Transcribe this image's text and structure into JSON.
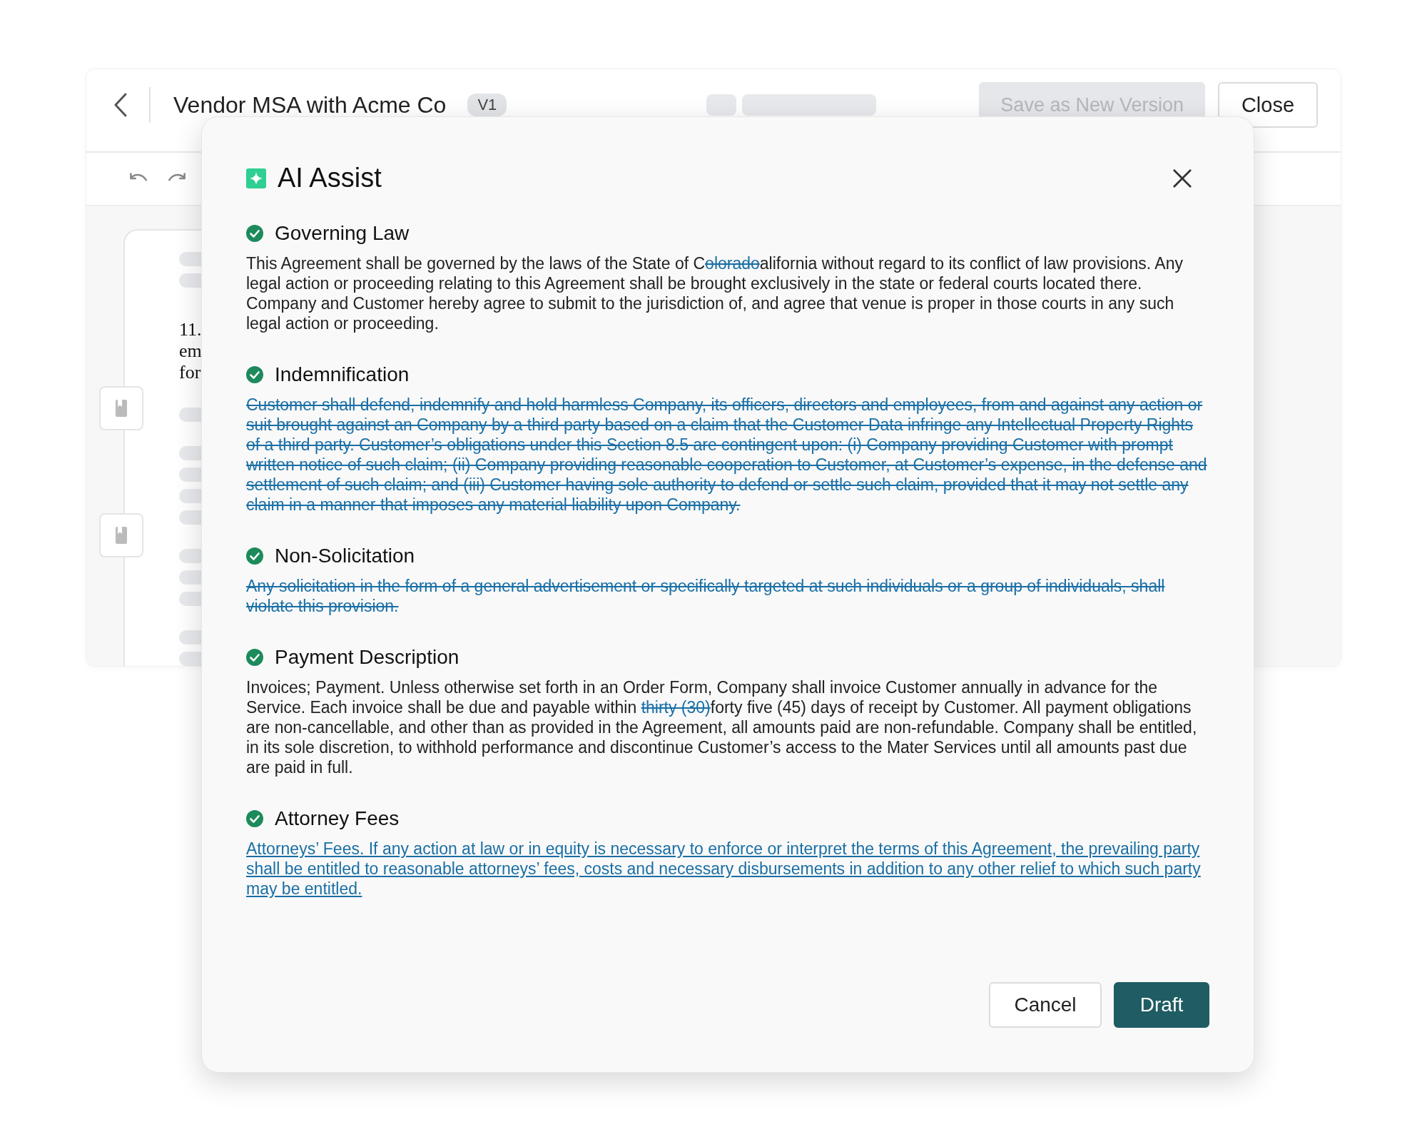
{
  "app": {
    "title": "Vendor MSA with Acme Co",
    "version": "V1",
    "save_button": {
      "label": "Save as New Version",
      "disabled": true
    },
    "close_button": {
      "label": "Close"
    }
  },
  "document": {
    "lines": [
      "11.",
      "em",
      "for"
    ]
  },
  "modal": {
    "title": "AI Assist",
    "sections": [
      {
        "heading": "Governing Law",
        "accepted": true,
        "segments": [
          {
            "kind": "plain",
            "text": "This Agreement shall be governed by the laws of the State of C"
          },
          {
            "kind": "deleted",
            "text": "olorado"
          },
          {
            "kind": "plain",
            "text": "alifornia without regard to its conflict of law provisions. Any legal action or proceeding relating to this Agreement shall be brought exclusively in the state or federal courts located there. Company and Customer hereby agree to submit to the jurisdiction of, and agree that venue is proper in those courts in any such legal action or proceeding."
          }
        ]
      },
      {
        "heading": "Indemnification",
        "accepted": true,
        "segments": [
          {
            "kind": "deleted",
            "text": "Customer shall defend, indemnify and hold harmless Company, its officers, directors and employees, from and against any action or suit brought against an Company by a third party based on a claim that the Customer Data infringe any Intellectual Property Rights of a third party. Customer’s obligations under this Section 8.5 are contingent upon: (i) Company providing Customer with prompt written notice of such claim; (ii) Company providing reasonable cooperation to Customer, at Customer’s expense, in the defense and settlement of such claim; and (iii) Customer having sole authority to defend or settle such claim, provided that it may not settle any claim in a manner that imposes any material liability upon Company."
          }
        ]
      },
      {
        "heading": "Non-Solicitation",
        "accepted": true,
        "segments": [
          {
            "kind": "deleted",
            "text": "Any solicitation in the form of a general advertisement or specifically targeted at such individuals or a group of individuals, shall violate this provision."
          }
        ]
      },
      {
        "heading": "Payment Description",
        "accepted": true,
        "segments": [
          {
            "kind": "plain",
            "text": "Invoices; Payment. Unless otherwise set forth in an Order Form, Company shall invoice Customer annually in advance for the Service. Each invoice shall be due and payable within "
          },
          {
            "kind": "deleted",
            "text": "thirty (30)"
          },
          {
            "kind": "plain",
            "text": "forty five (45) days of receipt by Customer. All payment obligations are non-cancellable, and other than as provided in the Agreement, all amounts paid are non-refundable. Company shall be entitled, in its sole discretion, to withhold performance and discontinue Customer’s access to the Mater Services until all amounts past due are paid in full."
          }
        ]
      },
      {
        "heading": "Attorney Fees",
        "accepted": true,
        "segments": [
          {
            "kind": "inserted",
            "text": "Attorneys’ Fees. If any action at law or in equity is necessary to enforce or interpret the terms of this Agreement, the prevailing party shall be entitled to reasonable attorneys’ fees, costs and necessary disbursements in addition to any other relief to which such party may be entitled."
          }
        ]
      }
    ],
    "buttons": [
      {
        "label": "Cancel",
        "kind": "secondary"
      },
      {
        "label": "Draft",
        "kind": "primary"
      }
    ]
  }
}
